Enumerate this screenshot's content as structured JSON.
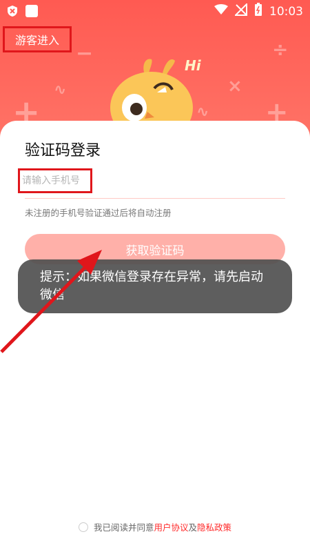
{
  "status_bar": {
    "time": "10:03"
  },
  "header": {
    "guest_label": "游客进入",
    "mascot_text": "Hi"
  },
  "login": {
    "title": "验证码登录",
    "phone_placeholder": "请输入手机号",
    "hint": "未注册的手机号验证通过后将自动注册",
    "get_code_label": "获取验证码"
  },
  "toast": {
    "text": "提示：如果微信登录存在异常，请先启动微信"
  },
  "agreement": {
    "prefix": "我已阅读并同意",
    "user_agreement": "用户协议",
    "and": "及",
    "privacy_policy": "隐私政策"
  },
  "colors": {
    "brand": "#ff5a52",
    "link": "#ff2a2a",
    "annotation": "#e0161b"
  }
}
